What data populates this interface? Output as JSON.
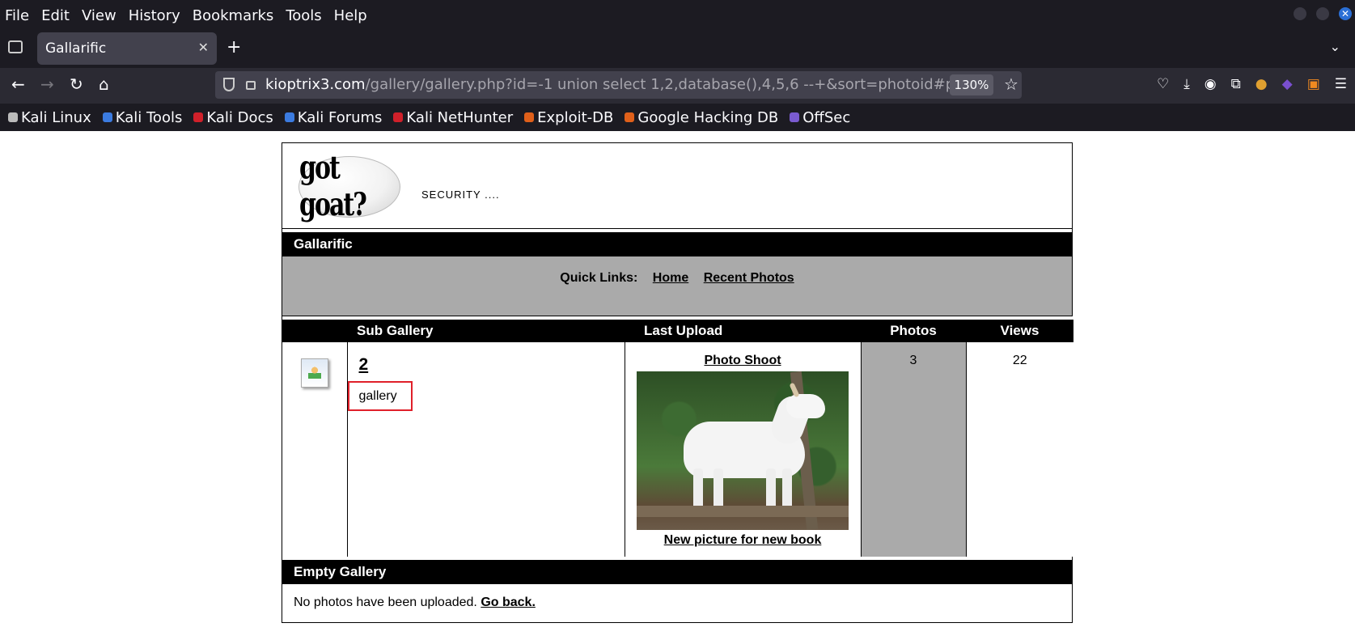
{
  "browser": {
    "menu": [
      "File",
      "Edit",
      "View",
      "History",
      "Bookmarks",
      "Tools",
      "Help"
    ],
    "tab_title": "Gallarific",
    "url_host": "kioptrix3.com",
    "url_rest": "/gallery/gallery.php?id=-1 union select 1,2,database(),4,5,6 --+&sort=photoid#phot",
    "zoom": "130%",
    "bookmarks": [
      {
        "label": "Kali Linux",
        "color": "#bbbbbb"
      },
      {
        "label": "Kali Tools",
        "color": "#3b7be0"
      },
      {
        "label": "Kali Docs",
        "color": "#d0202a"
      },
      {
        "label": "Kali Forums",
        "color": "#3b7be0"
      },
      {
        "label": "Kali NetHunter",
        "color": "#d0202a"
      },
      {
        "label": "Exploit-DB",
        "color": "#e0601a"
      },
      {
        "label": "Google Hacking DB",
        "color": "#e0601a"
      },
      {
        "label": "OffSec",
        "color": "#7a5bd0"
      }
    ]
  },
  "site": {
    "logo_text": "got goat?",
    "tagline": "SECURITY ....",
    "title_bar": "Gallarific",
    "quick_links_label": "Quick Links:",
    "quick_links": [
      "Home",
      "Recent Photos"
    ],
    "columns": [
      "Sub Gallery",
      "Last Upload",
      "Photos",
      "Views"
    ],
    "row": {
      "name": "2",
      "description": "gallery",
      "last_upload_title": "Photo Shoot",
      "last_upload_caption": "New picture for new book",
      "photos": "3",
      "views": "22"
    },
    "empty_title": "Empty Gallery",
    "empty_text": "No photos have been uploaded.",
    "go_back": "Go back."
  }
}
